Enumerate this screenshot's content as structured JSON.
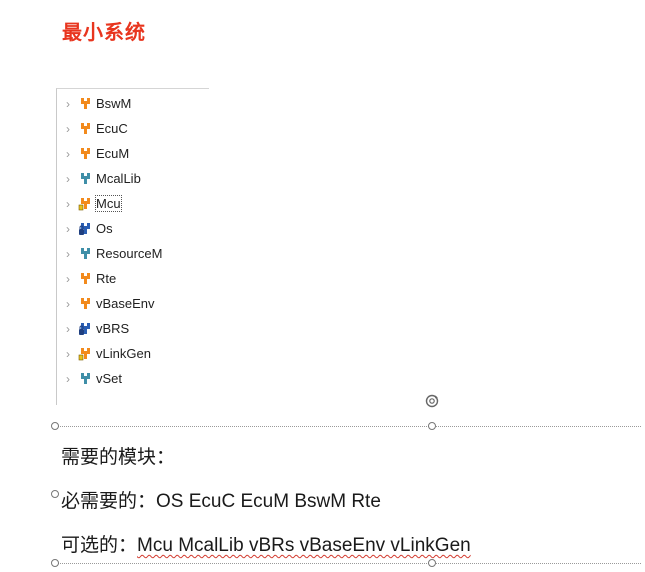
{
  "heading": "最小系统",
  "tree": {
    "items": [
      {
        "label": "BswM",
        "icon": "orange-module-icon"
      },
      {
        "label": "EcuC",
        "icon": "orange-module-icon"
      },
      {
        "label": "EcuM",
        "icon": "orange-module-icon"
      },
      {
        "label": "McalLib",
        "icon": "teal-module-icon"
      },
      {
        "label": "Mcu",
        "icon": "orange-warning-module-icon"
      },
      {
        "label": "Os",
        "icon": "blue-lock-module-icon"
      },
      {
        "label": "ResourceM",
        "icon": "teal-module-icon"
      },
      {
        "label": "Rte",
        "icon": "orange-module-icon"
      },
      {
        "label": "vBaseEnv",
        "icon": "orange-module-icon"
      },
      {
        "label": "vBRS",
        "icon": "blue-lock-module-icon"
      },
      {
        "label": "vLinkGen",
        "icon": "orange-warning-module-icon"
      },
      {
        "label": "vSet",
        "icon": "teal-module-icon"
      }
    ]
  },
  "notes": {
    "line1": "需要的模块：",
    "line2_prefix": "必需要的：",
    "line2_modules": "OS  EcuC EcuM BswM Rte",
    "line3_prefix": "可选的：",
    "line3_modules": "Mcu McalLib vBRs vBaseEnv vLinkGen"
  },
  "colors": {
    "heading": "#e8351e",
    "orange_icon": "#f28a1c",
    "teal_icon": "#3f8fa8",
    "blue_icon": "#2b5fb3",
    "spell_underline": "#d23a2e"
  }
}
